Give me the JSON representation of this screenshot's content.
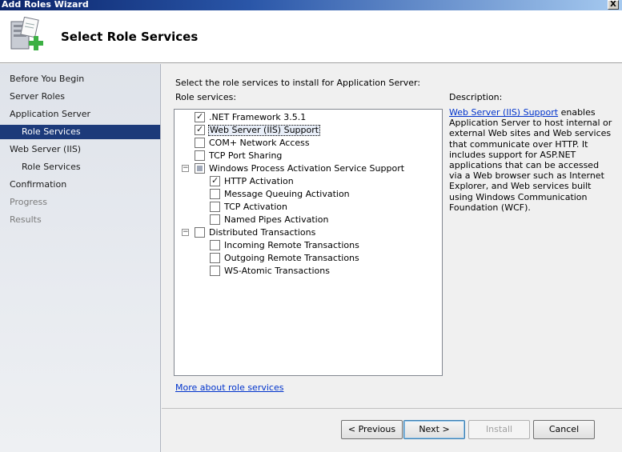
{
  "window": {
    "title": "Add Roles Wizard",
    "close_label": "X"
  },
  "header": {
    "title": "Select Role Services",
    "icon": "server-add-icon"
  },
  "sidebar": {
    "items": [
      {
        "label": "Before You Begin",
        "state": "normal"
      },
      {
        "label": "Server Roles",
        "state": "normal"
      },
      {
        "label": "Application Server",
        "state": "normal"
      },
      {
        "label": "Role Services",
        "state": "selected"
      },
      {
        "label": "Web Server (IIS)",
        "state": "normal"
      },
      {
        "label": "Role Services",
        "state": "normal"
      },
      {
        "label": "Confirmation",
        "state": "normal"
      },
      {
        "label": "Progress",
        "state": "disabled"
      },
      {
        "label": "Results",
        "state": "disabled"
      }
    ]
  },
  "main": {
    "instruction": "Select the role services to install for Application Server:",
    "role_services_label": "Role services:",
    "tree": [
      {
        "label": ".NET Framework 3.5.1",
        "checked": true
      },
      {
        "label": "Web Server (IIS) Support",
        "checked": true
      },
      {
        "label": "COM+ Network Access",
        "checked": false
      },
      {
        "label": "TCP Port Sharing",
        "checked": false
      },
      {
        "label": "Windows Process Activation Service Support",
        "checked": "mixed"
      },
      {
        "label": "HTTP Activation",
        "checked": true
      },
      {
        "label": "Message Queuing Activation",
        "checked": false
      },
      {
        "label": "TCP Activation",
        "checked": false
      },
      {
        "label": "Named Pipes Activation",
        "checked": false
      },
      {
        "label": "Distributed Transactions",
        "checked": false
      },
      {
        "label": "Incoming Remote Transactions",
        "checked": false
      },
      {
        "label": "Outgoing Remote Transactions",
        "checked": false
      },
      {
        "label": "WS-Atomic Transactions",
        "checked": false
      }
    ],
    "description_heading": "Description:",
    "description_link": "Web Server (IIS) Support",
    "description_text": " enables Application Server to host internal or external Web sites and Web services that communicate over HTTP. It includes support for ASP.NET applications that can be accessed via a Web browser such as Internet Explorer, and Web services built using Windows Communication Foundation (WCF).",
    "more_link": "More about role services"
  },
  "footer": {
    "previous": "< Previous",
    "next": "Next >",
    "install": "Install",
    "cancel": "Cancel"
  }
}
